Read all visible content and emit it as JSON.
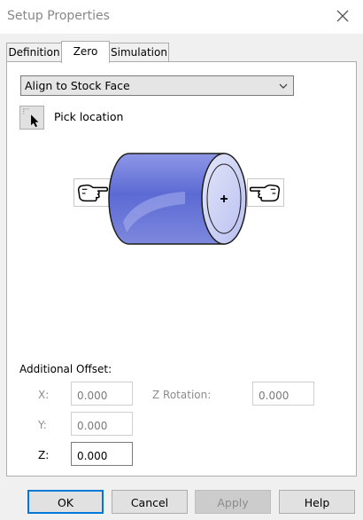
{
  "window": {
    "title": "Setup Properties",
    "close_icon": "close-icon"
  },
  "tabs": [
    {
      "label": "Definition",
      "active": false
    },
    {
      "label": "Zero",
      "active": true
    },
    {
      "label": "Simulation",
      "active": false
    }
  ],
  "zero": {
    "align_mode": "Align to Stock Face",
    "pick_label": "Pick location",
    "pick_icon": "cursor-pick-icon",
    "diagram_icons": [
      "pointing-hand-left-icon",
      "cylinder-stock-icon",
      "pointing-hand-right-icon"
    ]
  },
  "offset": {
    "section_label": "Additional Offset:",
    "x_label": "X:",
    "x_value": "0.000",
    "y_label": "Y:",
    "y_value": "0.000",
    "z_label": "Z:",
    "z_value": "0.000",
    "zrot_label": "Z Rotation:",
    "zrot_value": "0.000"
  },
  "buttons": {
    "ok": "OK",
    "cancel": "Cancel",
    "apply": "Apply",
    "help": "Help"
  },
  "colors": {
    "accent": "#0078d7",
    "cylinder": "#6a78d8",
    "panel": "#ffffff",
    "window": "#f0f0f0"
  }
}
